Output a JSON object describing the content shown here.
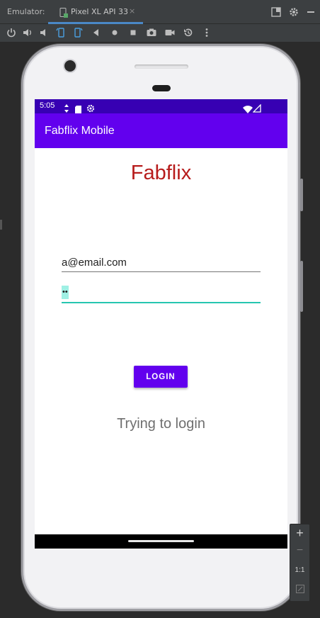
{
  "emulator": {
    "label": "Emulator:",
    "tab_title": "Pixel XL API 33",
    "tab_close": "×",
    "toolbar_icons": [
      "power-icon",
      "volume-up-icon",
      "volume-down-icon",
      "rotate-left-icon",
      "rotate-right-icon",
      "back-icon",
      "home-icon",
      "overview-icon",
      "camera-icon",
      "record-icon",
      "snapshot-icon",
      "more-icon"
    ]
  },
  "device": {
    "status_bar": {
      "time": "5:05",
      "icons": [
        "data-saver-icon",
        "sd-card-icon",
        "settings-icon",
        "wifi-icon",
        "signal-icon"
      ],
      "color": "#3700b3"
    },
    "app_bar": {
      "title": "Fabflix Mobile",
      "color": "#6200ee"
    },
    "screen": {
      "title": "Fabflix",
      "title_color": "#b71c1c",
      "email_value": "a@email.com",
      "password_value": "••",
      "login_button": "LOGIN",
      "status_message": "Trying to login"
    }
  },
  "zoom_controls": {
    "zoom_in": "+",
    "zoom_out": "−",
    "actual_size": "1:1"
  }
}
